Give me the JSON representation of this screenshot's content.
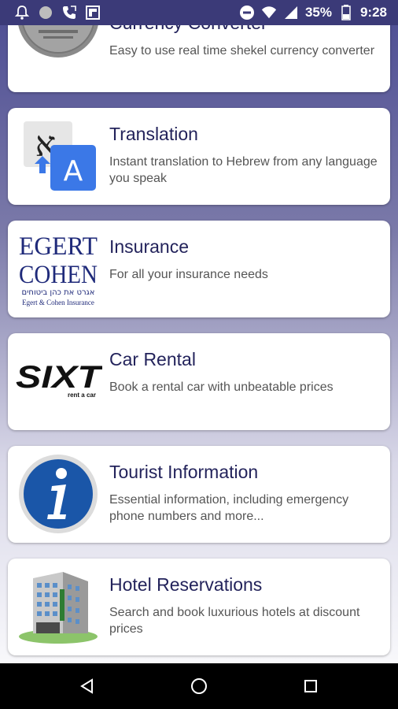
{
  "status_bar": {
    "battery": "35%",
    "time": "9:28",
    "icons": [
      "bell-icon",
      "circle-icon",
      "phone-icon",
      "flipboard-icon",
      "do-not-disturb-icon",
      "wifi-icon",
      "signal-icon",
      "battery-icon"
    ]
  },
  "cards": [
    {
      "title": "Currency Converter",
      "description": "Easy to use real time shekel currency converter",
      "image": "shekel-coin"
    },
    {
      "title": "Translation",
      "description": "Instant translation to Hebrew from any language you speak",
      "image": "translate-logo"
    },
    {
      "title": "Insurance",
      "description": "For all your insurance needs",
      "image": "egert-cohen-logo",
      "logo_text": {
        "line1": "EGERT",
        "line2": "COHEN",
        "hebrew": "אגרט את כהן ביטוחים",
        "sub": "Egert & Cohen Insurance"
      }
    },
    {
      "title": "Car Rental",
      "description": "Book a rental car with unbeatable prices",
      "image": "sixt-logo",
      "logo_text": {
        "brand": "SIXT",
        "sub": "rent a car"
      }
    },
    {
      "title": "Tourist Information",
      "description": "Essential information, including emergency phone numbers and more...",
      "image": "info-icon"
    },
    {
      "title": "Hotel Reservations",
      "description": "Search and book luxurious hotels at discount prices",
      "image": "hotel-building"
    }
  ],
  "nav_bar": {
    "buttons": [
      "back-icon",
      "home-icon",
      "recents-icon"
    ]
  }
}
